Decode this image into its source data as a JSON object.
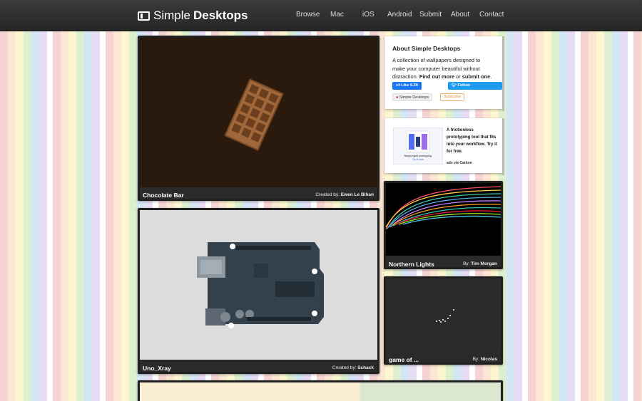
{
  "header": {
    "logo_light": "Simple",
    "logo_bold": "Desktops",
    "nav": [
      "Browse",
      "Mac",
      "iOS",
      "Android",
      "Submit",
      "About",
      "Contact"
    ]
  },
  "about": {
    "title": "About Simple Desktops",
    "text": "A collection of wallpapers designed to make your computer beautiful without distraction.",
    "find_out_more": "Find out more",
    "or": "or",
    "submit_one": "submit one",
    "period": ".",
    "like_label": "Like",
    "like_count": "9.2K",
    "follow_label": "Follow @simpledesktops",
    "pinterest_label": "Simple Desktops",
    "subscribe_label": "Subscribe"
  },
  "ad": {
    "text": "A frictionless prototyping tool that fits into your workflow. Try it for free.",
    "via": "ads via Carbon",
    "image_line1": "Simply rapid prototyping.",
    "image_line2": "Try it now"
  },
  "wallpapers": [
    {
      "title": "Chocolate Bar",
      "credit_label": "Created by:",
      "author": "Ewen Le Bihan"
    },
    {
      "title": "Uno_Xray",
      "credit_label": "Created by:",
      "author": "Schack"
    },
    {
      "title": "Northern Lights",
      "credit_label": "By:",
      "author": "Tim Morgan"
    },
    {
      "title": "game of ...",
      "credit_label": "By:",
      "author": "Nicolas"
    }
  ],
  "colors": {
    "header_bg": "#2c2c2c",
    "like_blue": "#1877f2",
    "follow_blue": "#1d9bf0",
    "chocolate_bg": "#2a1a0d",
    "chocolate": "#a0683a"
  },
  "icons": [
    "logo-monitor-icon",
    "facebook-icon",
    "twitter-icon",
    "pinterest-icon",
    "rss-icon"
  ]
}
